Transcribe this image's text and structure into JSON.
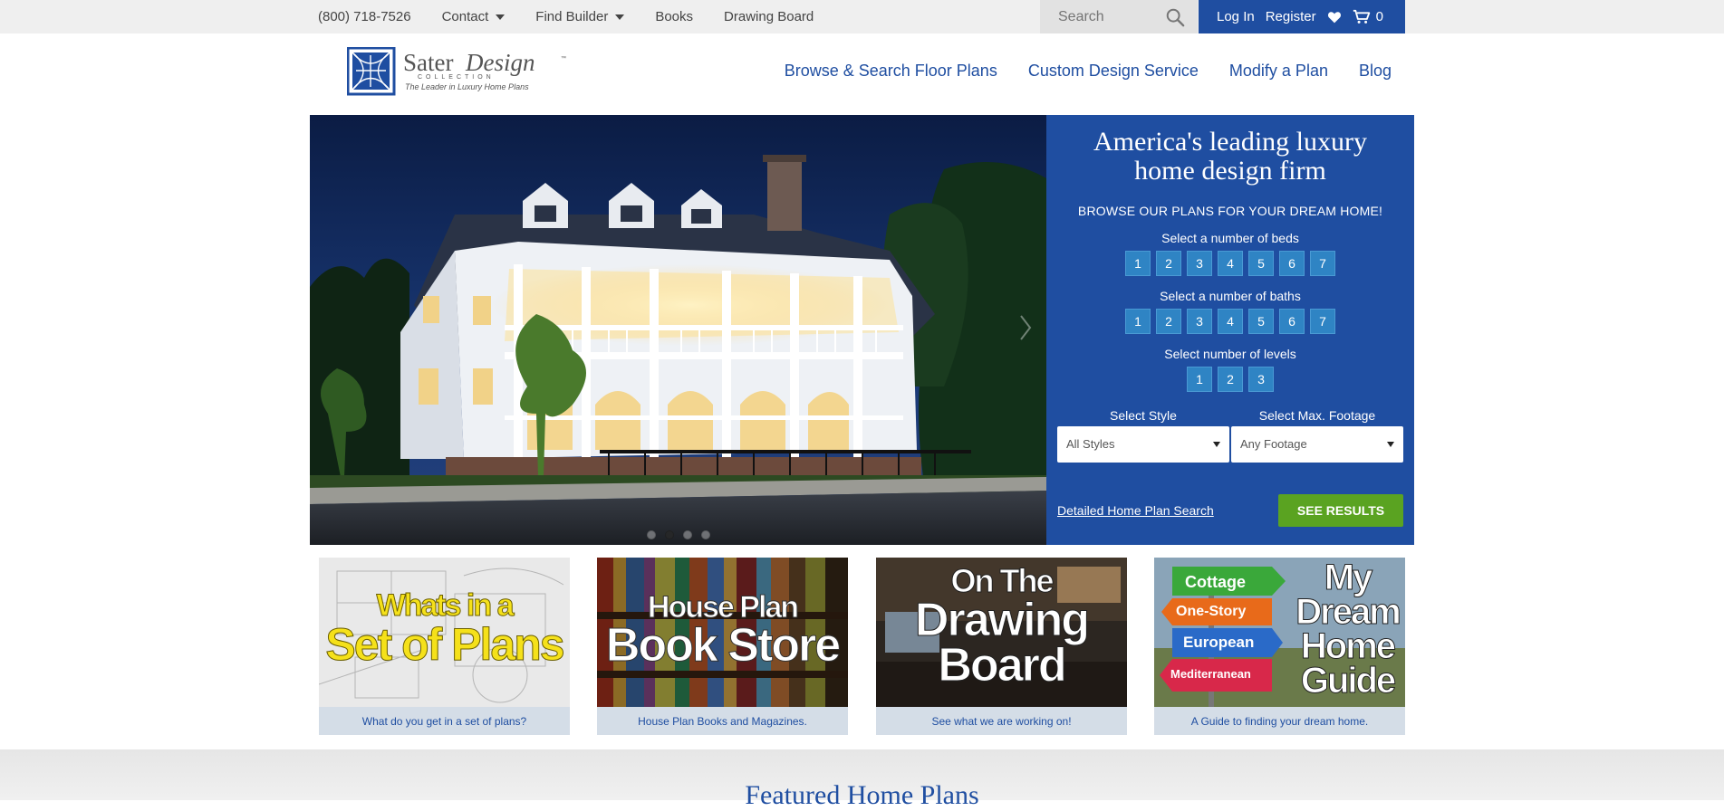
{
  "topbar": {
    "phone": "(800) 718-7526",
    "contact": "Contact",
    "find_builder": "Find Builder",
    "books": "Books",
    "drawing_board": "Drawing Board",
    "search_placeholder": "Search",
    "login": "Log In",
    "register": "Register",
    "cart_count": "0"
  },
  "logo": {
    "name_sater": "Sater",
    "name_design": "Design",
    "collection": "COLLECTION",
    "tagline": "The Leader in Luxury Home Plans"
  },
  "nav": {
    "browse": "Browse & Search Floor Plans",
    "custom": "Custom Design Service",
    "modify": "Modify a Plan",
    "blog": "Blog"
  },
  "panel": {
    "headline_1": "America's leading luxury",
    "headline_2": "home design firm",
    "subhead": "BROWSE OUR PLANS FOR YOUR DREAM HOME!",
    "beds_label": "Select a number of beds",
    "beds": [
      "1",
      "2",
      "3",
      "4",
      "5",
      "6",
      "7"
    ],
    "baths_label": "Select a number of baths",
    "baths": [
      "1",
      "2",
      "3",
      "4",
      "5",
      "6",
      "7"
    ],
    "levels_label": "Select number of levels",
    "levels": [
      "1",
      "2",
      "3"
    ],
    "style_label": "Select Style",
    "style_value": "All Styles",
    "footage_label": "Select Max. Footage",
    "footage_value": "Any Footage",
    "detail_link": "Detailed Home Plan Search",
    "see_results": "SEE RESULTS"
  },
  "tiles": [
    {
      "line1": "Whats in a",
      "line2": "Set of Plans",
      "caption": "What do you get in a set of plans?"
    },
    {
      "line1": "House Plan",
      "line2": "Book Store",
      "caption": "House Plan Books and Magazines."
    },
    {
      "line1": "On The",
      "line2": "Drawing",
      "line3": "Board",
      "caption": "See what we are working on!"
    },
    {
      "line1": "My",
      "line2": "Dream",
      "line3": "Home",
      "line4": "Guide",
      "signs": [
        "Cottage",
        "One-Story",
        "European",
        "Mediterranean"
      ],
      "caption": "A Guide to finding your dream home."
    }
  ],
  "featured_title": "Featured Home Plans",
  "colors": {
    "brand_blue": "#1f4ea1",
    "button_blue": "#2f84c4",
    "green": "#5aa321",
    "caption_bg": "#d4dde7"
  }
}
